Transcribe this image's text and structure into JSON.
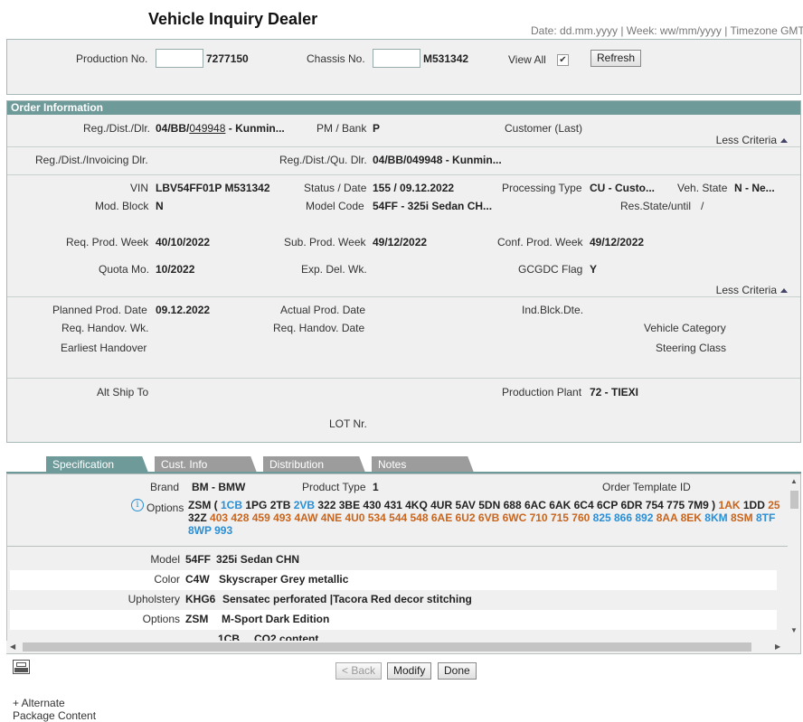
{
  "page": {
    "title": "Vehicle Inquiry Dealer",
    "dateline": "Date: dd.mm.yyyy | Week: ww/mm/yyyy | Timezone GMT"
  },
  "search": {
    "production_label": "Production No.",
    "production_value": "7277150",
    "chassis_label": "Chassis No.",
    "chassis_value": "M531342",
    "view_all_label": "View All",
    "view_all_checked": true,
    "refresh_label": "Refresh"
  },
  "order": {
    "header": "Order Information",
    "less_criteria": "Less Criteria",
    "reg_dist_dlr_label": "Reg./Dist./Dlr.",
    "reg_dist_dlr_prefix": "04/BB/",
    "reg_dist_dlr_link": "049948",
    "reg_dist_dlr_suffix": " - Kunmin...",
    "pm_bank_label": "PM / Bank",
    "pm_bank_value": "P",
    "customer_label": "Customer (Last)",
    "invoicing_label": "Reg./Dist./Invoicing Dlr.",
    "qu_dlr_label": "Reg./Dist./Qu. Dlr.",
    "qu_dlr_value": "04/BB/049948 - Kunmin...",
    "vin_label": "VIN",
    "vin_value": "LBV54FF01P  M531342",
    "status_label": "Status / Date",
    "status_value": "155 /  09.12.2022",
    "processing_label": "Processing Type",
    "processing_value": "CU - Custo...",
    "veh_state_label": "Veh. State",
    "veh_state_value": "N - Ne...",
    "mod_block_label": "Mod. Block",
    "mod_block_value": "N",
    "model_code_label": "Model Code",
    "model_code_value": "54FF - 325i Sedan CH...",
    "res_state_label": "Res.State/until",
    "res_state_value": "/",
    "req_prod_week_label": "Req. Prod. Week",
    "req_prod_week_value": "40/10/2022",
    "sub_prod_week_label": "Sub. Prod. Week",
    "sub_prod_week_value": "49/12/2022",
    "conf_prod_week_label": "Conf. Prod. Week",
    "conf_prod_week_value": "49/12/2022",
    "quota_label": "Quota Mo.",
    "quota_value": "10/2022",
    "exp_del_label": "Exp. Del. Wk.",
    "gcgdc_label": "GCGDC Flag",
    "gcgdc_value": "Y",
    "planned_label": "Planned Prod. Date",
    "planned_value": "09.12.2022",
    "actual_label": "Actual Prod. Date",
    "ind_blck_label": "Ind.Blck.Dte.",
    "req_handov_wk_label": "Req. Handov. Wk.",
    "req_handov_date_label": "Req. Handov. Date",
    "vehicle_category_label": "Vehicle Category",
    "earliest_handover_label": "Earliest Handover",
    "steering_class_label": "Steering Class",
    "alt_ship_label": "Alt Ship To",
    "plant_label": "Production Plant",
    "plant_value": "72 - TIEXI",
    "lot_label": "LOT Nr."
  },
  "tabs": [
    {
      "label": "Specification"
    },
    {
      "label": "Cust. Info"
    },
    {
      "label": "Distribution"
    },
    {
      "label": "Notes"
    }
  ],
  "spec": {
    "brand_label": "Brand",
    "brand_value": "BM - BMW",
    "product_type_label": "Product Type",
    "product_type_value": "1",
    "order_template_label": "Order Template ID",
    "options_label": "Options",
    "options_line1": [
      {
        "t": "ZSM ( ",
        "c": "dark"
      },
      {
        "t": "1CB",
        "c": "blue"
      },
      {
        "t": " 1PG 2TB ",
        "c": "dark"
      },
      {
        "t": "2VB",
        "c": "blue"
      },
      {
        "t": " 322 3BE 430 431 4KQ 4UR 5AV 5DN 688 6AC 6AK 6C4 6CP 6DR 754 775 7M9 ) ",
        "c": "dark"
      },
      {
        "t": "1AK",
        "c": "orange"
      },
      {
        "t": " 1DD ",
        "c": "dark"
      },
      {
        "t": "25",
        "c": "orange"
      }
    ],
    "options_line2": [
      {
        "t": "32Z ",
        "c": "dark"
      },
      {
        "t": "403 428 459 493 4AW 4NE 4U0 534 544 548 6AE 6U2 6VB 6WC 710 715 760 ",
        "c": "orange"
      },
      {
        "t": "825 866 892 ",
        "c": "blue"
      },
      {
        "t": "8AA 8EK ",
        "c": "orange"
      },
      {
        "t": "8KM ",
        "c": "blue"
      },
      {
        "t": "8SM ",
        "c": "orange"
      },
      {
        "t": "8TF",
        "c": "blue"
      }
    ],
    "options_line3": [
      {
        "t": "8WP 993",
        "c": "blue"
      }
    ],
    "model_label": "Model",
    "model_code": "54FF",
    "model_desc": "325i Sedan CHN",
    "color_label": "Color",
    "color_code": "C4W",
    "color_desc": "Skyscraper Grey metallic",
    "upholstery_label": "Upholstery",
    "upholstery_code": "KHG6",
    "upholstery_desc": "Sensatec perforated |Tacora Red decor stitching",
    "options_row_label": "Options",
    "options_row_code": "ZSM",
    "options_row_desc": "M-Sport Dark Edition",
    "sub_code": "1CB",
    "sub_desc": "CO2 content"
  },
  "actions": {
    "back": "< Back",
    "modify": "Modify",
    "done": "Done"
  },
  "footer": {
    "alternate": "+ Alternate",
    "package": "Package Content"
  },
  "colors": {
    "header_teal": "#6e9a9a",
    "tab_inactive": "#9c9c9c",
    "option_blue": "#2a8fd6",
    "option_orange": "#c8651f"
  }
}
